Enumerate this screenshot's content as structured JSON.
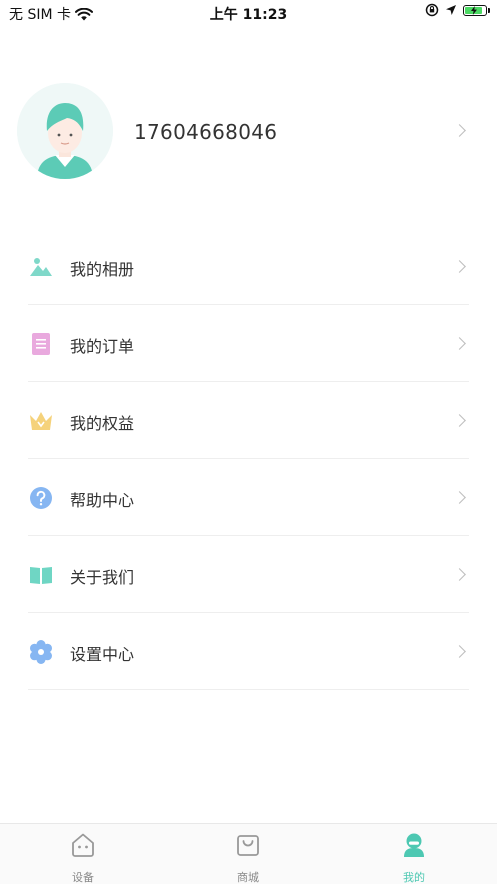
{
  "status_bar": {
    "carrier": "无 SIM 卡",
    "time": "上午 11:23"
  },
  "profile": {
    "phone": "17604668046"
  },
  "menu": {
    "items": [
      {
        "label": "我的相册",
        "icon": "photo-album-icon"
      },
      {
        "label": "我的订单",
        "icon": "order-list-icon"
      },
      {
        "label": "我的权益",
        "icon": "crown-icon"
      },
      {
        "label": "帮助中心",
        "icon": "help-question-icon"
      },
      {
        "label": "关于我们",
        "icon": "book-icon"
      },
      {
        "label": "设置中心",
        "icon": "settings-flower-icon"
      }
    ]
  },
  "tabbar": {
    "tabs": [
      {
        "label": "设备",
        "icon": "device-home-icon",
        "active": false
      },
      {
        "label": "商城",
        "icon": "shopping-bag-icon",
        "active": false
      },
      {
        "label": "我的",
        "icon": "profile-user-icon",
        "active": true
      }
    ]
  },
  "colors": {
    "accent": "#4dc8b2",
    "album": "#7fd8c9",
    "order": "#e9a9de",
    "crown": "#f5d27b",
    "help": "#86b6f2",
    "book": "#6fd6c4",
    "settings": "#86b6f2"
  }
}
